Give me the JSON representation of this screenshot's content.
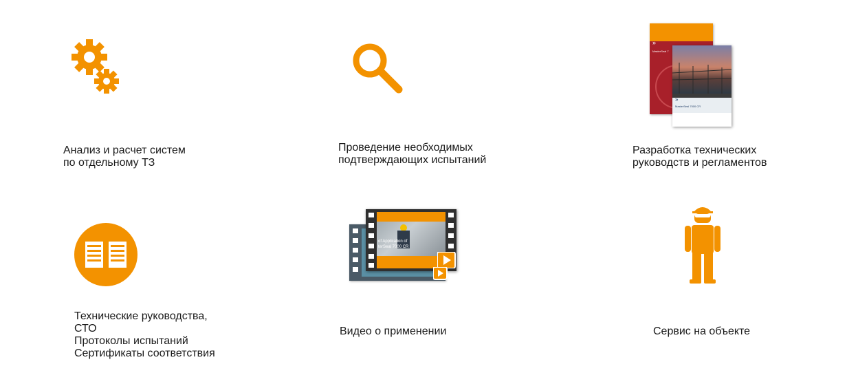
{
  "accent_color": "#f39200",
  "items": [
    {
      "icon": "gears-icon",
      "lines": [
        "Анализ и расчет систем",
        "по отдельному ТЗ"
      ]
    },
    {
      "icon": "magnifier-icon",
      "lines": [
        "Проведение необходимых",
        "подтверждающих испытаний"
      ]
    },
    {
      "icon": "brochure-image",
      "lines": [
        "Разработка технических",
        "руководств и регламентов"
      ],
      "brochure_back_title": "MasterSeal 7",
      "brochure_front_title": "MasterSeal 7000 CR"
    },
    {
      "icon": "book-icon",
      "lines": [
        "Технические руководства,",
        "СТО",
        "Протоколы испытаний",
        "Сертификаты соответствия"
      ]
    },
    {
      "icon": "video-film-icon",
      "lines": [
        "Видео о применении"
      ],
      "video_caption_1": "of Application of",
      "video_caption_2": "terSeal 7000 CR"
    },
    {
      "icon": "worker-icon",
      "lines": [
        "Сервис на объекте"
      ]
    }
  ]
}
